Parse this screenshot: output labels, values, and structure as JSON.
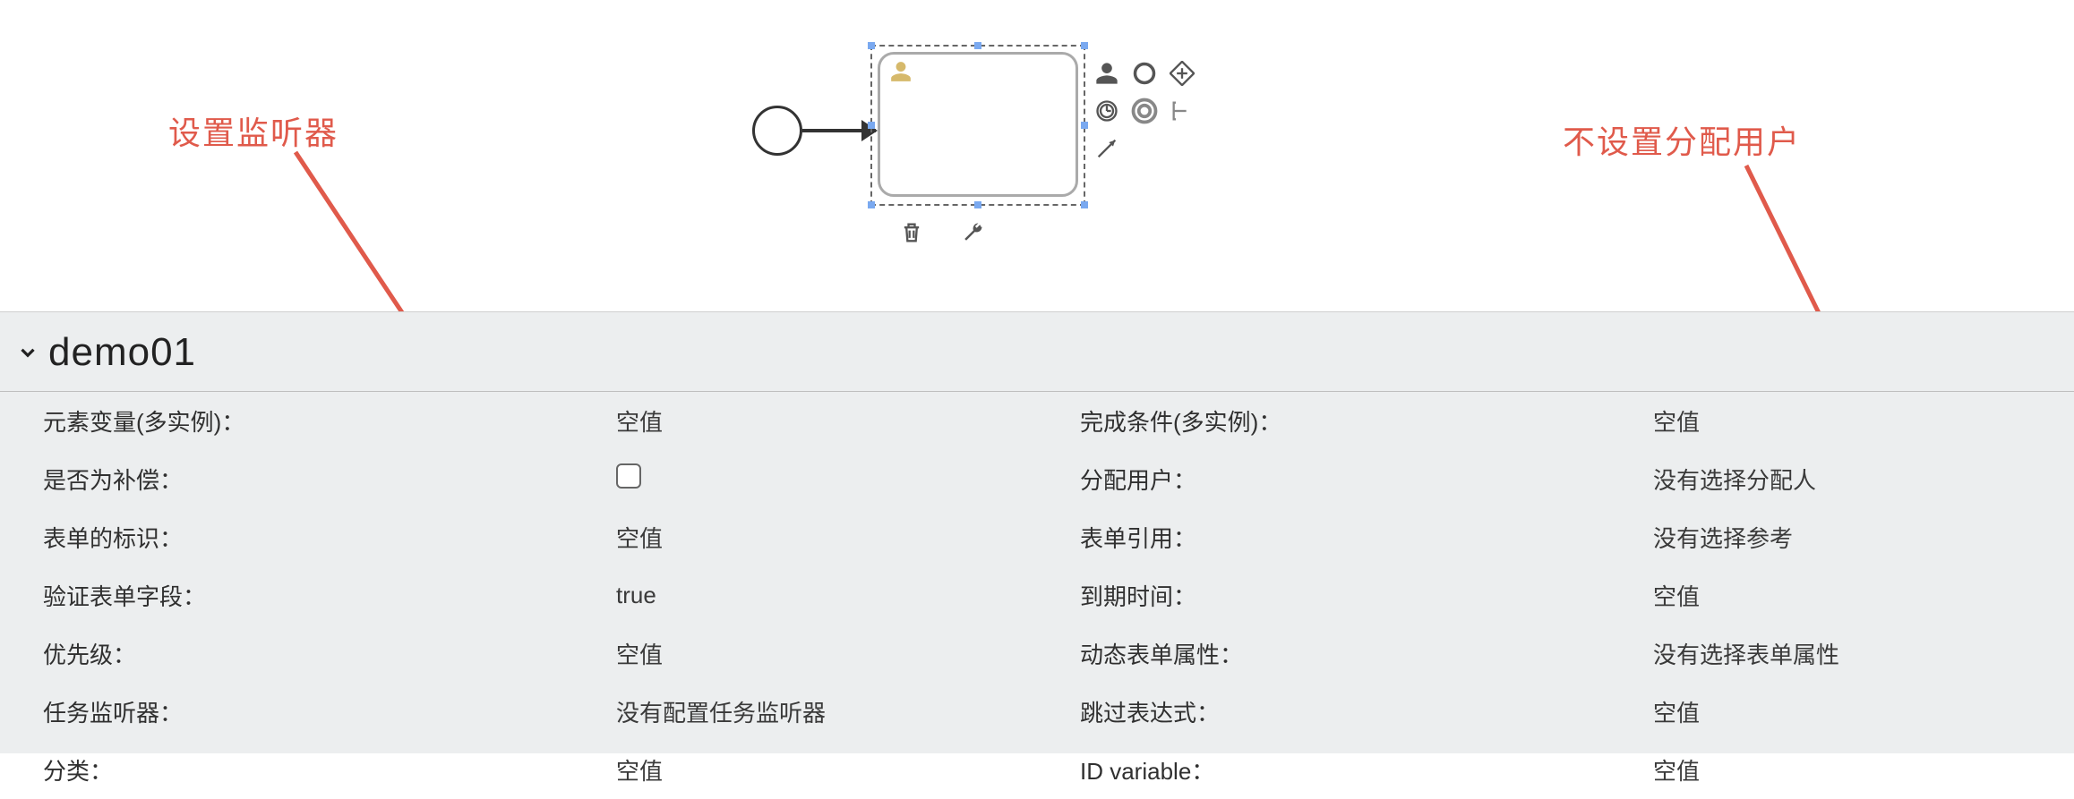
{
  "annotations": {
    "left_label": "设置监听器",
    "right_label": "不设置分配用户"
  },
  "header": {
    "title": "demo01"
  },
  "left_props": [
    {
      "label": "元素变量(多实例)：",
      "value": "空值"
    },
    {
      "label": "是否为补偿：",
      "value": "__checkbox__"
    },
    {
      "label": "表单的标识：",
      "value": "空值"
    },
    {
      "label": "验证表单字段：",
      "value": "true"
    },
    {
      "label": "优先级：",
      "value": "空值"
    },
    {
      "label": "任务监听器：",
      "value": "没有配置任务监听器"
    },
    {
      "label": "分类：",
      "value": "空值"
    }
  ],
  "right_props": [
    {
      "label": "完成条件(多实例)：",
      "value": "空值"
    },
    {
      "label": "分配用户：",
      "value": "没有选择分配人"
    },
    {
      "label": "表单引用：",
      "value": "没有选择参考"
    },
    {
      "label": "到期时间：",
      "value": "空值"
    },
    {
      "label": "动态表单属性：",
      "value": "没有选择表单属性"
    },
    {
      "label": "跳过表达式：",
      "value": "空值"
    },
    {
      "label": "ID variable：",
      "value": "空值"
    }
  ]
}
